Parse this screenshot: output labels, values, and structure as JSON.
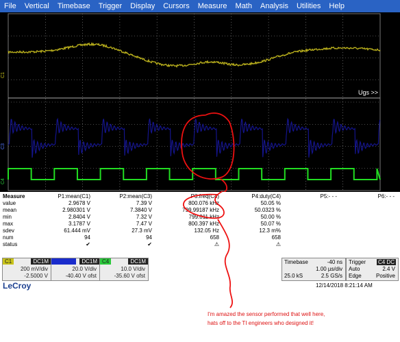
{
  "menu": [
    "File",
    "Vertical",
    "Timebase",
    "Trigger",
    "Display",
    "Cursors",
    "Measure",
    "Math",
    "Analysis",
    "Utilities",
    "Help"
  ],
  "scope": {
    "trace_label": "Ugs >>",
    "colors": {
      "c1": "#b8ae1c",
      "c3": "#14148c",
      "c4": "#22dd22",
      "grid": "#9a9a9a",
      "annotation": "#ee1111",
      "background": "#000000"
    },
    "markers": {
      "c1": "C1",
      "c3": "C3",
      "c4": "C4"
    }
  },
  "measure": {
    "title": "Measure",
    "params": [
      "P1:mean(C1)",
      "P2:mean(C3)",
      "P3:freq(C4)",
      "P4:duty(C4)",
      "P5:- - -",
      "P6:- - -"
    ],
    "rows": [
      {
        "label": "value",
        "cells": [
          "2.9678 V",
          "7.39 V",
          "800.076 kHz",
          "50.05 %",
          "",
          ""
        ]
      },
      {
        "label": "mean",
        "cells": [
          "2.980301 V",
          "7.3840 V",
          "799.99187 kHz",
          "50.0323 %",
          "",
          ""
        ]
      },
      {
        "label": "min",
        "cells": [
          "2.8404 V",
          "7.32 V",
          "799.011 kHz",
          "50.00 %",
          "",
          ""
        ]
      },
      {
        "label": "max",
        "cells": [
          "3.1787 V",
          "7.47 V",
          "800.397 kHz",
          "50.07 %",
          "",
          ""
        ]
      },
      {
        "label": "sdev",
        "cells": [
          "61.444 mV",
          "27.3 mV",
          "132.05 Hz",
          "12.3 m%",
          "",
          ""
        ]
      },
      {
        "label": "num",
        "cells": [
          "94",
          "94",
          "658",
          "658",
          "",
          ""
        ]
      },
      {
        "label": "status",
        "cells": [
          "✔",
          "✔",
          "⚠",
          "⚠",
          "",
          ""
        ]
      }
    ]
  },
  "channels": [
    {
      "name": "C1",
      "coupling": "DC1M",
      "scale": "200 mV/div",
      "offset": "-2.5000 V",
      "color": "#c8c31a"
    },
    {
      "name": "",
      "coupling": "DC1M",
      "scale": "20.0 V/div",
      "offset": "-40.40 V ofst",
      "color": "#1a2ccc"
    },
    {
      "name": "C4",
      "coupling": "DC1M",
      "scale": "10.0 V/div",
      "offset": "-35.60 V ofst",
      "color": "#29c93a"
    }
  ],
  "brand": "LeCroy",
  "timebase": {
    "label": "Timebase",
    "delay": "-40 ns",
    "div": "1.00 µs/div",
    "samples": "25.0 kS",
    "rate": "2.5 GS/s"
  },
  "trigger": {
    "label": "Trigger",
    "source": "C4 DC",
    "level": "2.4 V",
    "mode": "Auto",
    "type": "Edge",
    "slope": "Positive"
  },
  "datetime": "12/14/2018 8:21:14 AM",
  "note": [
    "I'm amazed the sensor performed that well here,",
    "hats off to the TI engineers who designed it!"
  ]
}
